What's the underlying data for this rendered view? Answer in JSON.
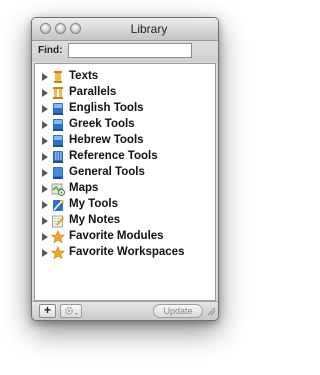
{
  "window": {
    "title": "Library"
  },
  "find": {
    "label": "Find:",
    "value": ""
  },
  "tree": {
    "items": [
      {
        "label": "Texts",
        "icon": "book-scroll-icon",
        "color": "#d98a1a"
      },
      {
        "label": "Parallels",
        "icon": "parallel-columns-icon",
        "color": "#d98a1a"
      },
      {
        "label": "English Tools",
        "icon": "english-tools-book-icon",
        "color": "#2d6fd0"
      },
      {
        "label": "Greek Tools",
        "icon": "greek-tools-book-icon",
        "color": "#2d6fd0"
      },
      {
        "label": "Hebrew Tools",
        "icon": "hebrew-tools-book-icon",
        "color": "#2d6fd0"
      },
      {
        "label": "Reference Tools",
        "icon": "reference-tools-book-icon",
        "color": "#2d6fd0"
      },
      {
        "label": "General Tools",
        "icon": "general-tools-book-icon",
        "color": "#2d6fd0"
      },
      {
        "label": "Maps",
        "icon": "map-icon",
        "color": "#3aa04a"
      },
      {
        "label": "My Tools",
        "icon": "my-tools-icon",
        "color": "#2d6fd0"
      },
      {
        "label": "My Notes",
        "icon": "notes-pencil-icon",
        "color": "#888888"
      },
      {
        "label": "Favorite Modules",
        "icon": "star-icon",
        "color": "#f0a020"
      },
      {
        "label": "Favorite Workspaces",
        "icon": "star-icon",
        "color": "#f0a020"
      }
    ]
  },
  "bottom": {
    "add_label": "+",
    "action_icon": "gear-icon",
    "update_label": "Update"
  }
}
